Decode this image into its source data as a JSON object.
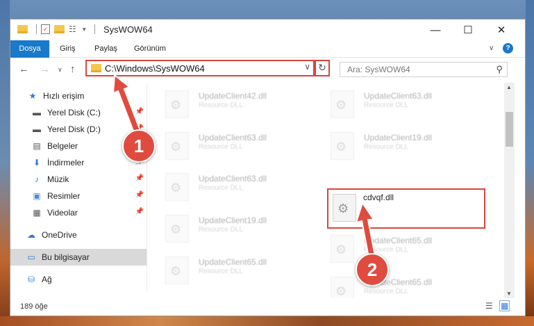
{
  "window": {
    "title": "SysWOW64"
  },
  "ribbon": {
    "tabs": [
      "Dosya",
      "Giriş",
      "Paylaş",
      "Görünüm"
    ]
  },
  "address": {
    "path": "C:\\Windows\\SysWOW64",
    "search_placeholder": "Ara: SysWOW64"
  },
  "nav": {
    "items": [
      {
        "label": "Hızlı erişim",
        "icon": "star-icon",
        "pinned": false
      },
      {
        "label": "Yerel Disk (C:)",
        "icon": "drive-icon",
        "pinned": true
      },
      {
        "label": "Yerel Disk (D:)",
        "icon": "drive-icon",
        "pinned": true
      },
      {
        "label": "Belgeler",
        "icon": "document-icon",
        "pinned": true
      },
      {
        "label": "İndirmeler",
        "icon": "download-icon",
        "pinned": true
      },
      {
        "label": "Müzik",
        "icon": "music-icon",
        "pinned": true
      },
      {
        "label": "Resimler",
        "icon": "pictures-icon",
        "pinned": true
      },
      {
        "label": "Videolar",
        "icon": "video-icon",
        "pinned": true
      },
      {
        "label": "OneDrive",
        "icon": "cloud-icon",
        "pinned": false
      },
      {
        "label": "Bu bilgisayar",
        "icon": "computer-icon",
        "pinned": false
      },
      {
        "label": "Ağ",
        "icon": "network-icon",
        "pinned": false
      }
    ]
  },
  "files": [
    {
      "name": "UpdateClient42.dll",
      "type": "Resource DLL"
    },
    {
      "name": "UpdateClient63.dll",
      "type": "Resource DLL"
    },
    {
      "name": "UpdateClient63.dll",
      "type": "Resource DLL"
    },
    {
      "name": "UpdateClient19.dll",
      "type": "Resource DLL"
    },
    {
      "name": "UpdateClient63.dll",
      "type": "Resource DLL"
    },
    {
      "name": "cdvqf.dll",
      "type": ""
    },
    {
      "name": "UpdateClient19.dll",
      "type": "Resource DLL"
    },
    {
      "name": "UpdateClient65.dll",
      "type": "Resource DLL"
    },
    {
      "name": "UpdateClient65.dll",
      "type": "Resource DLL"
    },
    {
      "name": "UpdateClient65.dll",
      "type": "Resource DLL"
    }
  ],
  "status": {
    "count": "189 öğe"
  },
  "markers": [
    "1",
    "2"
  ],
  "colors": {
    "accent": "#1979ca",
    "highlight": "#d9453b"
  }
}
